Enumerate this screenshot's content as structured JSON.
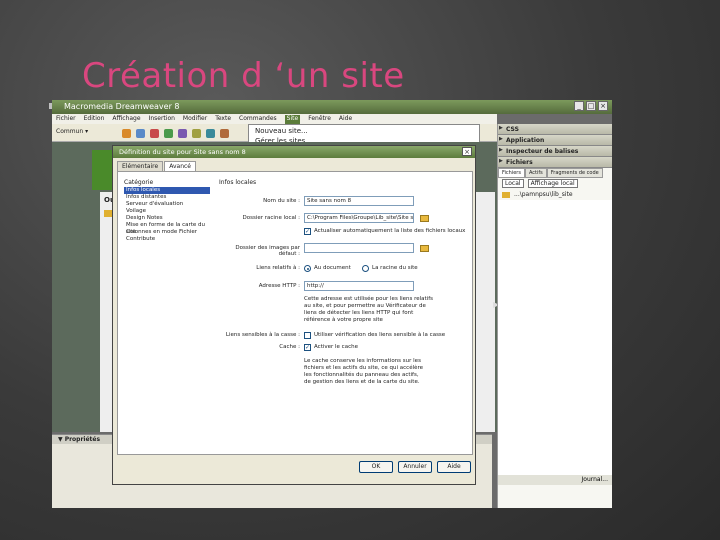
{
  "slide": {
    "title": "Création d ‘un site"
  },
  "app": {
    "window_title": "Macromedia Dreamweaver 8",
    "win_buttons": [
      "_",
      "□",
      "×"
    ],
    "menu": [
      "Fichier",
      "Edition",
      "Affichage",
      "Insertion",
      "Modifier",
      "Texte",
      "Commandes",
      "Site",
      "Fenêtre",
      "Aide"
    ],
    "active_menu": "Site",
    "site_menu_items": [
      "Nouveau site...",
      "Gérer les sites..."
    ],
    "toolbar_select": "Commun ▾",
    "doc_heading": "Ouv",
    "properties_label": "▼ Propriétés",
    "collapse_arrow": "▶"
  },
  "right_panel": {
    "panels": [
      "CSS",
      "Application",
      "Inspecteur de balises",
      "Fichiers"
    ],
    "tabs": [
      "Fichiers",
      "Actifs",
      "Fragments de code"
    ],
    "site_select": "Local",
    "view_select": "Affichage local",
    "path": "...\\pamnpsu\\lib_site",
    "footer_left": "",
    "footer_right": "Journal..."
  },
  "dialog": {
    "title": "Définition du site pour Site sans nom 8",
    "close": "×",
    "tabs": [
      "Elémentaire",
      "Avancé"
    ],
    "active_tab": "Avancé",
    "category_label": "Catégorie",
    "categories": [
      "Infos locales",
      "Infos distantes",
      "Serveur d'évaluation",
      "Voilage",
      "Design Notes",
      "Mise en forme de la carte du site",
      "Colonnes en mode Fichier",
      "Contribute"
    ],
    "selected_category": "Infos locales",
    "section_title": "Infos locales",
    "site_name_label": "Nom du site :",
    "site_name_value": "Site sans nom 8",
    "root_label": "Dossier racine local :",
    "root_value": "C:\\Program Files\\Groupe\\Lib_site\\Site sans",
    "auto_refresh_label": "Actualiser automatiquement la liste des fichiers locaux",
    "images_label": "Dossier des images par défaut :",
    "images_value": "",
    "links_label": "Liens relatifs à :",
    "links_option1": "Au document",
    "links_option2": "La racine du site",
    "http_label": "Adresse HTTP :",
    "http_value": "http://",
    "http_note": "Cette adresse est utilisée pour les liens relatifs au site, et pour permettre au Vérificateur de liens de détecter les liens HTTP qui font référence à votre propre site",
    "case_label": "Liens sensibles à la casse :",
    "case_option": "Utiliser vérification des liens sensible à la casse",
    "cache_label": "Cache :",
    "cache_option": "Activer le cache",
    "cache_note": "Le cache conserve les informations sur les fichiers et les actifs du site, ce qui accélère les fonctionnalités du panneau des actifs, de gestion des liens et de la carte du site.",
    "ok": "OK",
    "cancel": "Annuler",
    "help": "Aide"
  }
}
